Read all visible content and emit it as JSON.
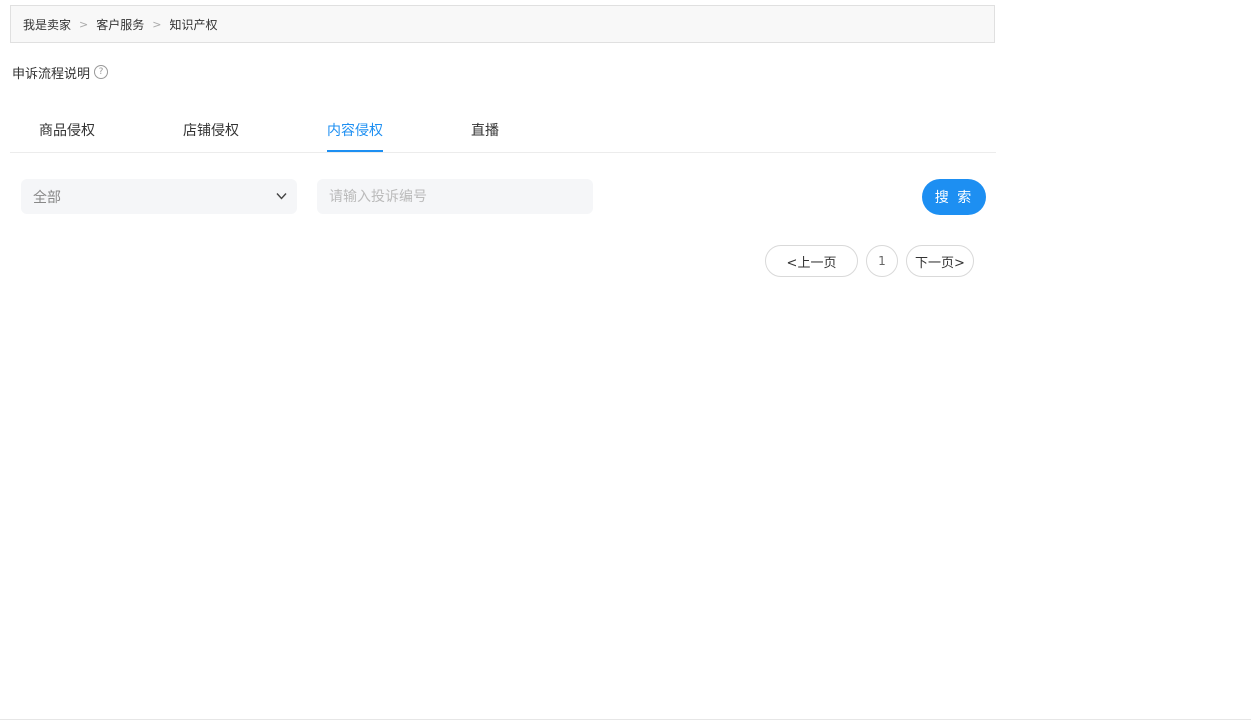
{
  "breadcrumb": {
    "items": [
      "我是卖家",
      "客户服务",
      "知识产权"
    ],
    "separator": ">"
  },
  "process_info": {
    "label": "申诉流程说明",
    "help_glyph": "?"
  },
  "tabs": [
    {
      "label": "商品侵权",
      "active": false
    },
    {
      "label": "店铺侵权",
      "active": false
    },
    {
      "label": "内容侵权",
      "active": true
    },
    {
      "label": "直播",
      "active": false
    }
  ],
  "filter": {
    "selected": "全部"
  },
  "search": {
    "placeholder": "请输入投诉编号",
    "value": "",
    "button_label": "搜 索"
  },
  "pagination": {
    "prev_label": "<上一页",
    "current_page": "1",
    "next_label": "下一页>"
  },
  "colors": {
    "accent": "#1d8ff2",
    "input_bg": "#f5f6f8",
    "breadcrumb_bg": "#f8f8f8"
  }
}
